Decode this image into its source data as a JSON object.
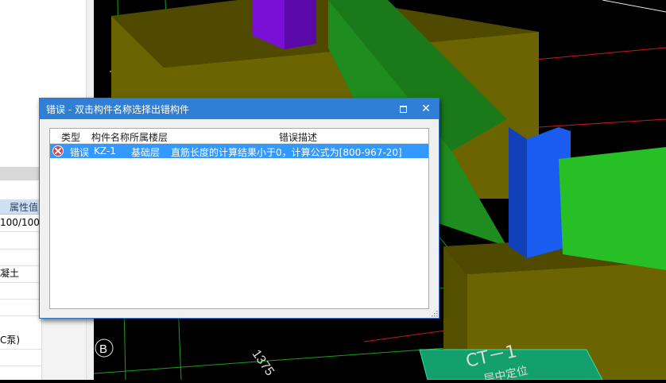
{
  "property_panel": {
    "header": "属性值",
    "rows": [
      "100/100",
      "",
      "",
      "凝土",
      "",
      "",
      "C泵)",
      ""
    ]
  },
  "viewport": {
    "axis_label": "B",
    "dimension_label": "1375",
    "component_label": "CT－1",
    "sub_label": "层中定位"
  },
  "dialog": {
    "title": "错误 - 双击构件名称选择出错构件",
    "maximize_icon": "maximize-icon",
    "close_icon": "close-icon",
    "close_glyph": "✕",
    "columns": [
      "类型",
      "构件名称",
      "所属楼层",
      "错误描述"
    ],
    "rows": [
      {
        "icon": "error-icon",
        "type": "错误",
        "name": "KZ-1",
        "floor": "基础层",
        "description": "直筋长度的计算结果小于0，计算公式为[800-967-20]",
        "selected": true
      }
    ]
  },
  "colors": {
    "title_bar": "#2f7fd6",
    "selection": "#3399ff",
    "block_olive": "#6b6400",
    "beam_green": "#1e8c1e",
    "column_blue": "#1a5cf0",
    "column_purple": "#7a10d8"
  }
}
